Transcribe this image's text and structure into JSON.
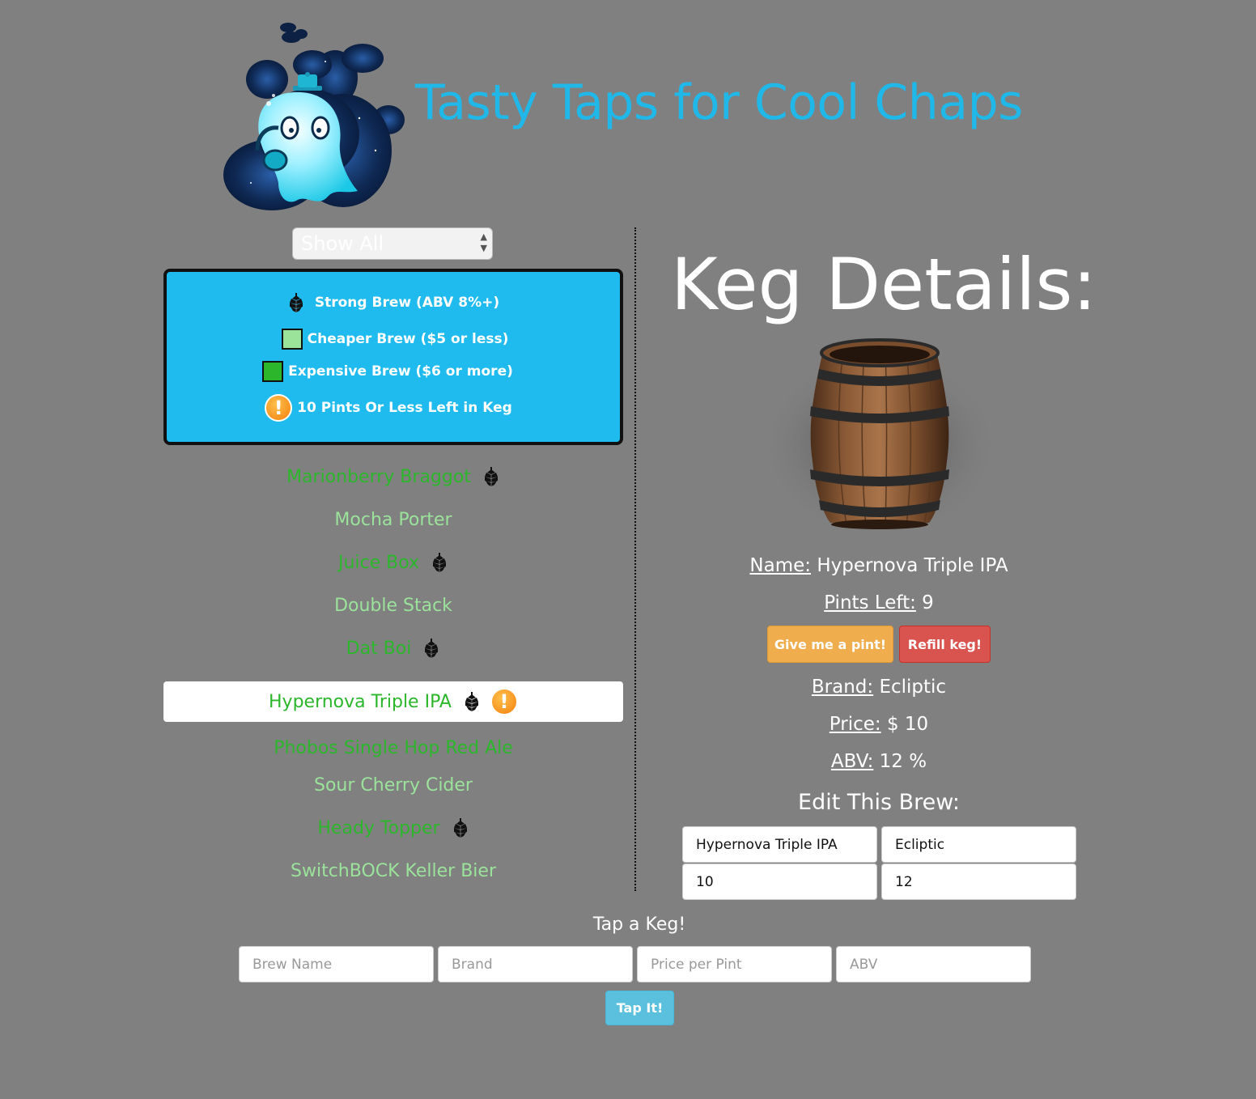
{
  "header": {
    "title": "Tasty Taps for Cool Chaps"
  },
  "filter": {
    "selected": "Show All"
  },
  "legend": {
    "strong": "Strong Brew (ABV 8%+)",
    "cheap": "Cheaper Brew ($5 or less)",
    "expensive": "Expensive Brew ($6 or more)",
    "low": "10 Pints Or Less Left in Keg",
    "cheap_color": "#9be29b",
    "expensive_color": "#2bb62b"
  },
  "kegs": [
    {
      "name": "Marionberry Braggot",
      "color": "#2bb62b",
      "strong": true,
      "low": false,
      "selected": false
    },
    {
      "name": "Mocha Porter",
      "color": "#9be29b",
      "strong": false,
      "low": false,
      "selected": false
    },
    {
      "name": "Juice Box",
      "color": "#2bb62b",
      "strong": true,
      "low": false,
      "selected": false
    },
    {
      "name": "Double Stack",
      "color": "#9be29b",
      "strong": false,
      "low": false,
      "selected": false
    },
    {
      "name": "Dat Boi",
      "color": "#2bb62b",
      "strong": true,
      "low": false,
      "selected": false
    },
    {
      "name": "Hypernova Triple IPA",
      "color": "#2bb62b",
      "strong": true,
      "low": true,
      "selected": true
    },
    {
      "name": "Phobos Single Hop Red Ale",
      "color": "#2bb62b",
      "strong": false,
      "low": false,
      "selected": false
    },
    {
      "name": "Sour Cherry Cider",
      "color": "#9be29b",
      "strong": false,
      "low": false,
      "selected": false
    },
    {
      "name": "Heady Topper",
      "color": "#2bb62b",
      "strong": true,
      "low": false,
      "selected": false
    },
    {
      "name": "SwitchBOCK Keller Bier",
      "color": "#9be29b",
      "strong": false,
      "low": false,
      "selected": false
    }
  ],
  "details": {
    "heading": "Keg Details:",
    "name_label": "Name:",
    "name": "Hypernova Triple IPA",
    "pints_label": "Pints Left:",
    "pints": "9",
    "give_pint": "Give me a pint!",
    "refill": "Refill keg!",
    "brand_label": "Brand:",
    "brand": "Ecliptic",
    "price_label": "Price:",
    "price": "$ 10",
    "abv_label": "ABV:",
    "abv": "12 %"
  },
  "edit": {
    "title": "Edit This Brew:",
    "name_value": "Hypernova Triple IPA",
    "brand_value": "Ecliptic",
    "price_value": "10",
    "abv_value": "12"
  },
  "tap": {
    "title": "Tap a Keg!",
    "name_placeholder": "Brew Name",
    "brand_placeholder": "Brand",
    "price_placeholder": "Price per Pint",
    "abv_placeholder": "ABV",
    "button": "Tap It!"
  },
  "icons": {
    "logo": "ghost-logo",
    "strong": "hop-icon",
    "low": "warning-icon",
    "keg_image": "barrel-image"
  }
}
